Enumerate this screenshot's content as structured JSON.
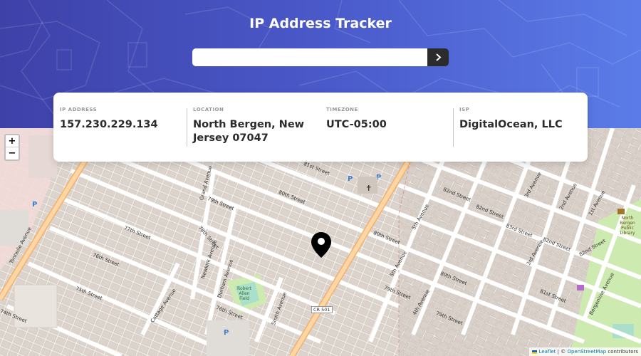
{
  "header": {
    "title": "IP Address Tracker",
    "search": {
      "value": "",
      "placeholder": ""
    },
    "submit_icon": "chevron-right-icon"
  },
  "info": {
    "ip": {
      "label": "IP ADDRESS",
      "value": "157.230.229.134"
    },
    "location": {
      "label": "LOCATION",
      "value": "North Bergen, New Jersey 07047"
    },
    "timezone": {
      "label": "TIMEZONE",
      "value": "UTC-05:00"
    },
    "isp": {
      "label": "ISP",
      "value": "DigitalOcean, LLC"
    }
  },
  "map": {
    "zoom_in": "+",
    "zoom_out": "−",
    "marker_icon": "location-pin-icon",
    "labels": {
      "tonnelle": "Tonnelle Avenue",
      "grand": "Grand Avenue",
      "newkirk": "Newkirk Avenue",
      "durham": "Durham Avenue",
      "cottage": "Cottage Avenue",
      "smith": "Smith Avenue",
      "s79": "79th Street",
      "s78": "78th Street",
      "s77": "77th Street",
      "s76a": "76th Street",
      "s76b": "76th Street",
      "s75": "75th Street",
      "s74": "74th Street",
      "s80a": "80th Street",
      "s80b": "80th Street",
      "s81": "81st Street",
      "s79b": "79th Street",
      "s79c": "79th Street",
      "s80c": "80th Street",
      "s81b": "81st Street",
      "s82a": "82nd Street",
      "s82b": "82nd Street",
      "s82c": "82nd Street",
      "s82d": "82nd Street",
      "s83": "83rd Street",
      "fifth": "5th Avenue",
      "fifth2": "5th Avenue",
      "fourth": "4th Avenue",
      "third": "3rd Avenue",
      "third2": "3rd Avenue",
      "second": "2nd Avenue",
      "first": "1st Avenue",
      "bergenline": "Bergenline Avenue",
      "park": "Robert Allen Field",
      "cr501": "CR 501",
      "library": "North Bergen Public Library"
    },
    "attribution": {
      "leaflet": "Leaflet",
      "sep": " | © ",
      "osm": "OpenStreetMap",
      "tail": " contributors"
    }
  }
}
